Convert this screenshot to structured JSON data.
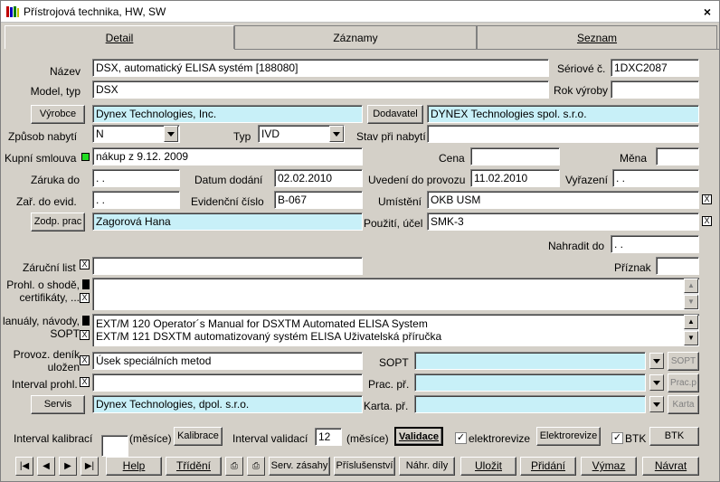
{
  "window": {
    "title": "Přístrojová technika, HW, SW",
    "close": "×"
  },
  "tabs": [
    {
      "label": "Detail",
      "active": true
    },
    {
      "label": "Záznamy",
      "active": false
    },
    {
      "label": "Seznam",
      "active": false
    }
  ],
  "labels": {
    "nazev": "Název",
    "seriove": "Sériové č.",
    "model": "Model, typ",
    "rok": "Rok výroby",
    "zpusob": "Způsob nabytí",
    "typ": "Typ",
    "stav": "Stav při nabytí",
    "kupni": "Kupní smlouva",
    "cena": "Cena",
    "mena": "Měna",
    "zaruka": "Záruka do",
    "datum_dodani": "Datum dodání",
    "uvedeni": "Uvedení do provozu",
    "vyrazeni": "Vyřazení",
    "zar_evid": "Zař. do  evid.",
    "evid_cislo": "Evidenční číslo",
    "umisteni": "Umístění",
    "pouziti": "Použití, účel",
    "nahradit": "Nahradit do",
    "zarucni_list": "Záruční list",
    "priznak": "Příznak",
    "prohl_1": "Prohl. o shodě,",
    "prohl_2": "certifikáty, ...",
    "manualy_1": "lanuály, návody,",
    "manualy_2": "SOPT",
    "provoz_1": "Provoz. deník",
    "provoz_2": "uložen",
    "sopt": "SOPT",
    "interval_prohl": "Interval prohl.",
    "prac_pr": "Prac. př.",
    "karta_pr": "Karta. př.",
    "interval_kalibraci": "Interval kalibrací",
    "mesice1": "(měsíce)",
    "interval_validaci": "Interval validací",
    "mesice2": "(měsíce)",
    "elektrorevize": "elektrorevize",
    "btk": "BTK"
  },
  "values": {
    "nazev": "DSX, automatický ELISA systém  [188080]",
    "seriove": "1DXC2087",
    "model": "DSX",
    "rok": "",
    "vyrobce": "Dynex Technologies, Inc.",
    "dodavatel": "DYNEX Technologies spol. s.r.o.",
    "zpusob": "N",
    "typ": "IVD",
    "stav": "",
    "kupni": "nákup z 9.12. 2009",
    "cena": "",
    "mena": "",
    "zaruka": " . .",
    "datum_dodani": "02.02.2010",
    "uvedeni": "11.02.2010",
    "vyrazeni": " . .",
    "zar_evid": " . .",
    "evid_cislo": "B-067",
    "umisteni": "OKB USM",
    "zodp": "Zagorová Hana",
    "pouziti": "SMK-3",
    "nahradit": " . .",
    "zarucni_list": "",
    "priznak": "",
    "manualy_line1": "EXT/M 120 Operator´s Manual for DSXTM Automated ELISA System",
    "manualy_line2": "EXT/M 121 DSXTM automatizovaný systém ELISA Uživatelská příručka",
    "provoz": "Úsek speciálních metod",
    "sopt": "",
    "interval_prohl": "",
    "prac_pr": "",
    "servis": "Dynex Technologies, dpol. s.r.o.",
    "karta_pr": "",
    "interval_kalibraci": "",
    "interval_validaci": "12",
    "elektrorevize_checked": "✓",
    "btk_checked": "✓"
  },
  "buttons": {
    "vyrobce": "Výrobce",
    "dodavatel": "Dodavatel",
    "zodp": "Zodp. prac",
    "servis": "Servis",
    "sopt": "SOPT",
    "prac_p": "Prac.p",
    "karta": "Karta",
    "kalibrace": "Kalibrace",
    "validace": "Validace",
    "elektrorevize": "Elektrorevize",
    "btk": "BTK",
    "help": "Help",
    "trideni": "Třídění",
    "serv_zasahy": "Serv. zásahy",
    "prislusenstvi": "Příslušenství",
    "nahr_dily": "Náhr. díly",
    "ulozit": "Uložit",
    "pridani": "Přidání",
    "vymaz": "Výmaz",
    "navrat": "Návrat"
  },
  "colors": {
    "window_bg": "#d4d0c8",
    "highlight_field": "#c8f0f8",
    "indicator": "#22dd22"
  }
}
